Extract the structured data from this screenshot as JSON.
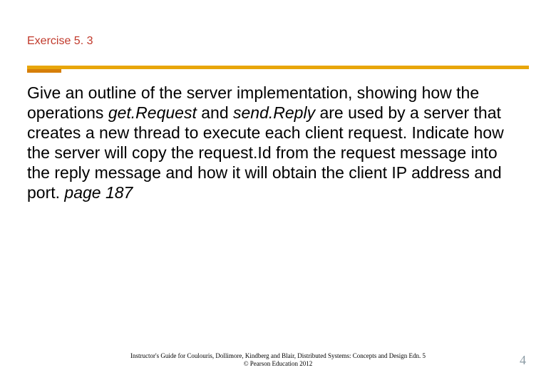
{
  "title": "Exercise 5. 3",
  "body": {
    "pre1": "Give an outline of the server implementation, showing how the operations ",
    "em1": "get.Request",
    "mid1": " and ",
    "em2": "send.Reply",
    "post1": " are used by a server that creates a new thread to execute each client request. Indicate how the server will copy the request.Id from the request message into the reply message and how it will obtain the client IP address and port.    ",
    "pageref": "page 187"
  },
  "footer": {
    "line1": "Instructor's Guide for  Coulouris, Dollimore, Kindberg and Blair,  Distributed Systems: Concepts and Design   Edn. 5",
    "line2": "©  Pearson Education 2012"
  },
  "pagenum": "4"
}
